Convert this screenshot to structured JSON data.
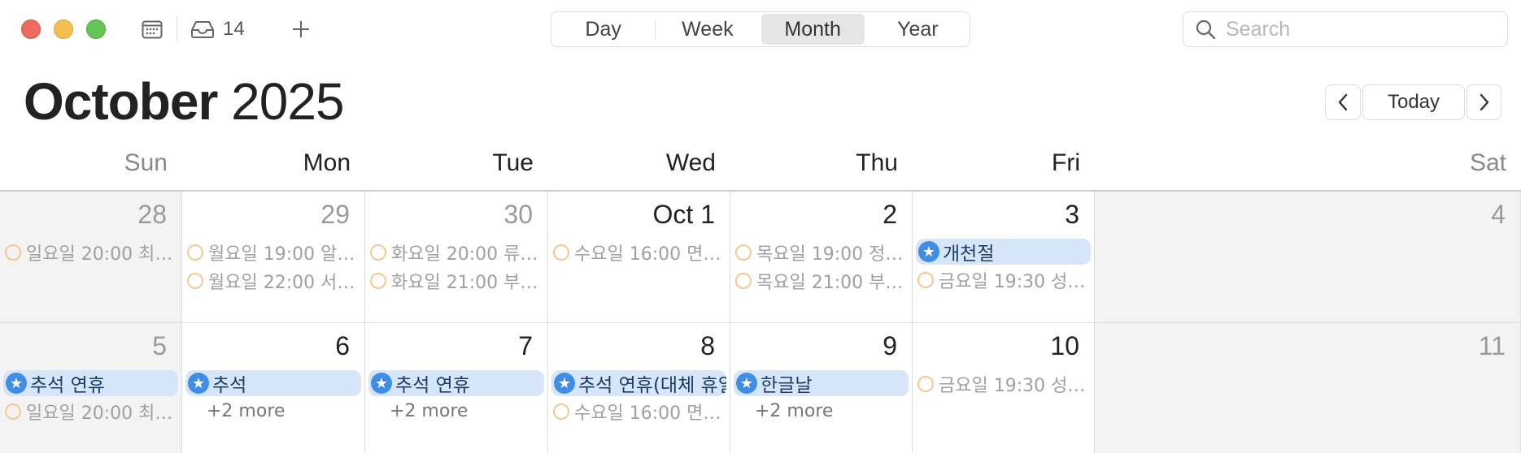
{
  "toolbar": {
    "inbox_count": "14",
    "view_tabs": [
      "Day",
      "Week",
      "Month",
      "Year"
    ],
    "active_view": "Month",
    "search_placeholder": "Search"
  },
  "header": {
    "month": "October",
    "year": "2025",
    "today_label": "Today"
  },
  "weekdays": [
    "Sun",
    "Mon",
    "Tue",
    "Wed",
    "Thu",
    "Fri",
    "Sat"
  ],
  "weeks": [
    {
      "days": [
        {
          "label": "28",
          "dim": true,
          "allday": null,
          "events": [
            "일요일 20:00 최준..."
          ],
          "more": null
        },
        {
          "label": "29",
          "dim": true,
          "allday": null,
          "events": [
            "월요일 19:00 알고…",
            "월요일 22:00 서현..."
          ],
          "more": null
        },
        {
          "label": "30",
          "dim": true,
          "allday": null,
          "events": [
            "화요일 20:00 류재...",
            "화요일 21:00 부캠…"
          ],
          "more": null
        },
        {
          "label": "Oct 1",
          "dim": false,
          "allday": null,
          "events": [
            "수요일 16:00 면접…"
          ],
          "more": null
        },
        {
          "label": "2",
          "dim": false,
          "allday": null,
          "events": [
            "목요일 19:00 정지...",
            "목요일 21:00 부캠…"
          ],
          "more": null
        },
        {
          "label": "3",
          "dim": false,
          "allday": "개천절",
          "events": [
            "금요일 19:30 성도..."
          ],
          "more": null
        },
        {
          "label": "4",
          "dim": true,
          "allday": null,
          "events": [],
          "more": null
        }
      ]
    },
    {
      "days": [
        {
          "label": "5",
          "dim": true,
          "allday": "추석 연휴",
          "events": [
            "일요일 20:00 최준..."
          ],
          "more": null
        },
        {
          "label": "6",
          "dim": false,
          "allday": "추석",
          "events": [],
          "more": "+2 more"
        },
        {
          "label": "7",
          "dim": false,
          "allday": "추석 연휴",
          "events": [],
          "more": "+2 more"
        },
        {
          "label": "8",
          "dim": false,
          "allday": "추석 연휴(대체 휴일)",
          "events": [
            "수요일 16:00 면접…"
          ],
          "more": null
        },
        {
          "label": "9",
          "dim": false,
          "allday": "한글날",
          "events": [],
          "more": "+2 more"
        },
        {
          "label": "10",
          "dim": false,
          "allday": null,
          "events": [
            "금요일 19:30 성도..."
          ],
          "more": null
        },
        {
          "label": "11",
          "dim": true,
          "allday": null,
          "events": [],
          "more": null
        }
      ]
    }
  ]
}
